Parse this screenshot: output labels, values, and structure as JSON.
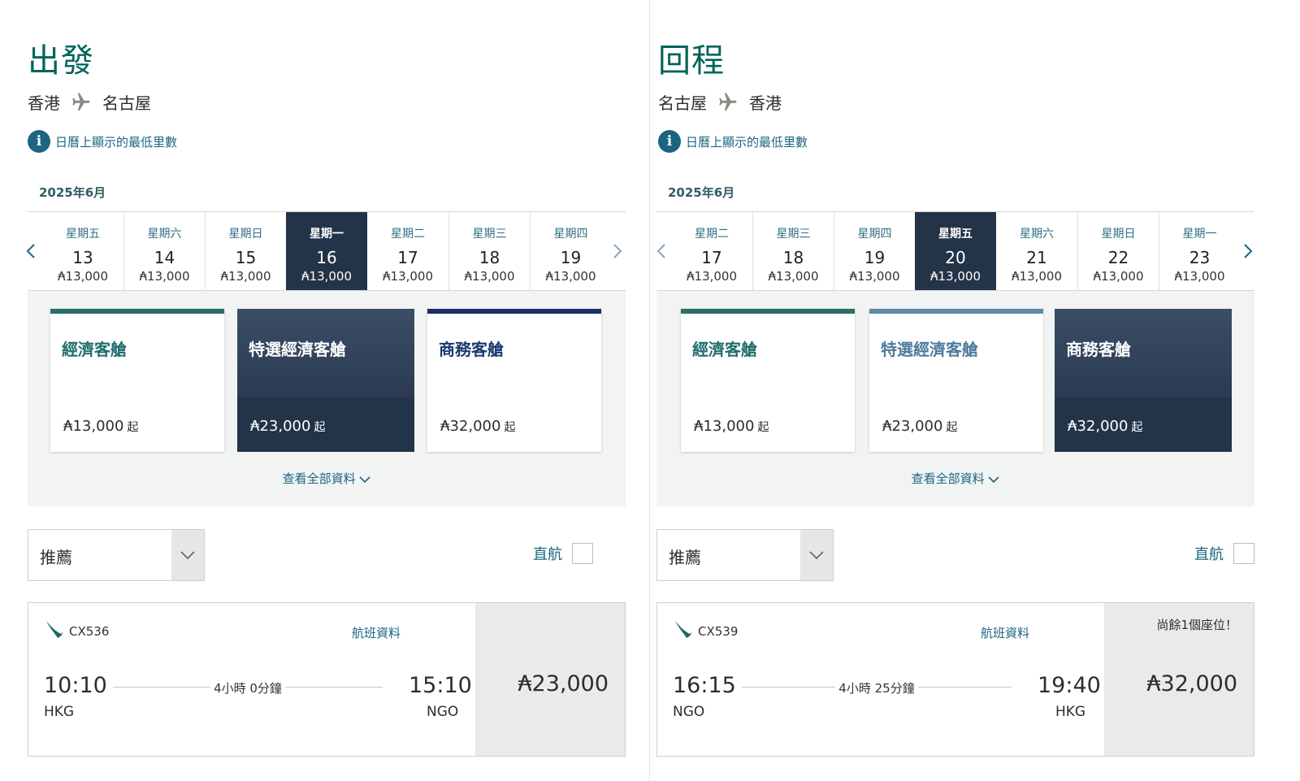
{
  "outbound": {
    "title": "出發",
    "route": {
      "from": "香港",
      "to": "名古屋"
    },
    "info_text": "日曆上顯示的最低里數",
    "month_label": "2025年6月",
    "dates": [
      {
        "dow": "星期五",
        "day": "13",
        "price": "₳13,000",
        "selected": false
      },
      {
        "dow": "星期六",
        "day": "14",
        "price": "₳13,000",
        "selected": false
      },
      {
        "dow": "星期日",
        "day": "15",
        "price": "₳13,000",
        "selected": false
      },
      {
        "dow": "星期一",
        "day": "16",
        "price": "₳13,000",
        "selected": true
      },
      {
        "dow": "星期二",
        "day": "17",
        "price": "₳13,000",
        "selected": false
      },
      {
        "dow": "星期三",
        "day": "18",
        "price": "₳13,000",
        "selected": false
      },
      {
        "dow": "星期四",
        "day": "19",
        "price": "₳13,000",
        "selected": false
      }
    ],
    "cabins": [
      {
        "name": "經濟客艙",
        "price": "₳13,000",
        "suffix": "起",
        "selected": false
      },
      {
        "name": "特選經濟客艙",
        "price": "₳23,000",
        "suffix": "起",
        "selected": true
      },
      {
        "name": "商務客艙",
        "price": "₳32,000",
        "suffix": "起",
        "selected": false
      }
    ],
    "see_all": "查看全部資料",
    "sort_value": "推薦",
    "nonstop_label": "直航",
    "flight": {
      "number": "CX536",
      "info_link": "航班資料",
      "dep_time": "10:10",
      "dep_code": "HKG",
      "duration": "4小時 0分鐘",
      "arr_time": "15:10",
      "arr_code": "NGO",
      "price": "₳23,000",
      "seats_note": ""
    }
  },
  "inbound": {
    "title": "回程",
    "route": {
      "from": "名古屋",
      "to": "香港"
    },
    "info_text": "日曆上顯示的最低里數",
    "month_label": "2025年6月",
    "dates": [
      {
        "dow": "星期二",
        "day": "17",
        "price": "₳13,000",
        "selected": false
      },
      {
        "dow": "星期三",
        "day": "18",
        "price": "₳13,000",
        "selected": false
      },
      {
        "dow": "星期四",
        "day": "19",
        "price": "₳13,000",
        "selected": false
      },
      {
        "dow": "星期五",
        "day": "20",
        "price": "₳13,000",
        "selected": true
      },
      {
        "dow": "星期六",
        "day": "21",
        "price": "₳13,000",
        "selected": false
      },
      {
        "dow": "星期日",
        "day": "22",
        "price": "₳13,000",
        "selected": false
      },
      {
        "dow": "星期一",
        "day": "23",
        "price": "₳13,000",
        "selected": false
      }
    ],
    "cabins": [
      {
        "name": "經濟客艙",
        "price": "₳13,000",
        "suffix": "起",
        "selected": false
      },
      {
        "name": "特選經濟客艙",
        "price": "₳23,000",
        "suffix": "起",
        "selected": false
      },
      {
        "name": "商務客艙",
        "price": "₳32,000",
        "suffix": "起",
        "selected": true
      }
    ],
    "see_all": "查看全部資料",
    "sort_value": "推薦",
    "nonstop_label": "直航",
    "flight": {
      "number": "CX539",
      "info_link": "航班資料",
      "dep_time": "16:15",
      "dep_code": "NGO",
      "duration": "4小時 25分鐘",
      "arr_time": "19:40",
      "arr_code": "HKG",
      "price": "₳32,000",
      "seats_note": "尚餘1個座位！"
    }
  },
  "colors": {
    "brand_green": "#00645a",
    "link_blue": "#1b6580",
    "selected_navy": "#233348"
  }
}
